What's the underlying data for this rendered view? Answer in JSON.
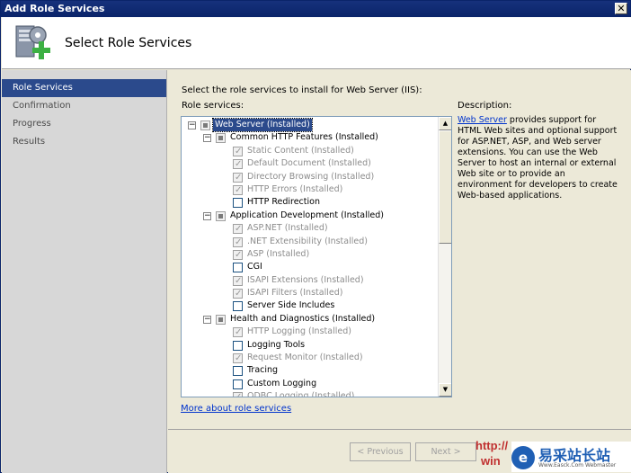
{
  "window": {
    "title": "Add Role Services",
    "close_glyph": "✕"
  },
  "header": {
    "title": "Select Role Services",
    "icon": "server-add-icon"
  },
  "sidebar": {
    "items": [
      {
        "label": "Role Services",
        "active": true
      },
      {
        "label": "Confirmation",
        "active": false
      },
      {
        "label": "Progress",
        "active": false
      },
      {
        "label": "Results",
        "active": false
      }
    ]
  },
  "main": {
    "intro": "Select the role services to install for Web Server (IIS):",
    "role_services_label": "Role services:",
    "description_label": "Description:",
    "description_link": "Web Server",
    "description_text": " provides support for HTML Web sites and optional support for ASP.NET, ASP, and Web server extensions. You can use the Web Server to host an internal or external Web site or to provide an environment for developers to create Web-based applications.",
    "more_link": "More about role services"
  },
  "tree": [
    {
      "label": "Web Server  (Installed)",
      "level": 0,
      "expander": "−",
      "state": "tri",
      "selected": true,
      "disabled": false
    },
    {
      "label": "Common HTTP Features  (Installed)",
      "level": 1,
      "expander": "−",
      "state": "tri",
      "selected": false,
      "disabled": false
    },
    {
      "label": "Static Content  (Installed)",
      "level": 2,
      "state": "chk",
      "disabled": true
    },
    {
      "label": "Default Document  (Installed)",
      "level": 2,
      "state": "chk",
      "disabled": true
    },
    {
      "label": "Directory Browsing  (Installed)",
      "level": 2,
      "state": "chk",
      "disabled": true
    },
    {
      "label": "HTTP Errors  (Installed)",
      "level": 2,
      "state": "chk",
      "disabled": true
    },
    {
      "label": "HTTP Redirection",
      "level": 2,
      "state": "empty",
      "disabled": false
    },
    {
      "label": "Application Development  (Installed)",
      "level": 1,
      "expander": "−",
      "state": "tri",
      "disabled": false
    },
    {
      "label": "ASP.NET  (Installed)",
      "level": 2,
      "state": "chk",
      "disabled": true
    },
    {
      "label": ".NET Extensibility  (Installed)",
      "level": 2,
      "state": "chk",
      "disabled": true
    },
    {
      "label": "ASP  (Installed)",
      "level": 2,
      "state": "chk",
      "disabled": true
    },
    {
      "label": "CGI",
      "level": 2,
      "state": "empty",
      "disabled": false
    },
    {
      "label": "ISAPI Extensions  (Installed)",
      "level": 2,
      "state": "chk",
      "disabled": true
    },
    {
      "label": "ISAPI Filters  (Installed)",
      "level": 2,
      "state": "chk",
      "disabled": true
    },
    {
      "label": "Server Side Includes",
      "level": 2,
      "state": "empty",
      "disabled": false
    },
    {
      "label": "Health and Diagnostics  (Installed)",
      "level": 1,
      "expander": "−",
      "state": "tri",
      "disabled": false
    },
    {
      "label": "HTTP Logging  (Installed)",
      "level": 2,
      "state": "chk",
      "disabled": true
    },
    {
      "label": "Logging Tools",
      "level": 2,
      "state": "empty",
      "disabled": false
    },
    {
      "label": "Request Monitor  (Installed)",
      "level": 2,
      "state": "chk",
      "disabled": true
    },
    {
      "label": "Tracing",
      "level": 2,
      "state": "empty",
      "disabled": false
    },
    {
      "label": "Custom Logging",
      "level": 2,
      "state": "empty",
      "disabled": false
    },
    {
      "label": "ODBC Logging  (Installed)",
      "level": 2,
      "state": "chk",
      "disabled": true
    }
  ],
  "buttons": {
    "previous": "< Previous",
    "next": "Next >"
  },
  "watermark": {
    "url_text": "http://",
    "url_text2": "win",
    "logo_text": "e",
    "cn": "易采站长站",
    "en": "Www.Easck.Com  Webmaster"
  }
}
